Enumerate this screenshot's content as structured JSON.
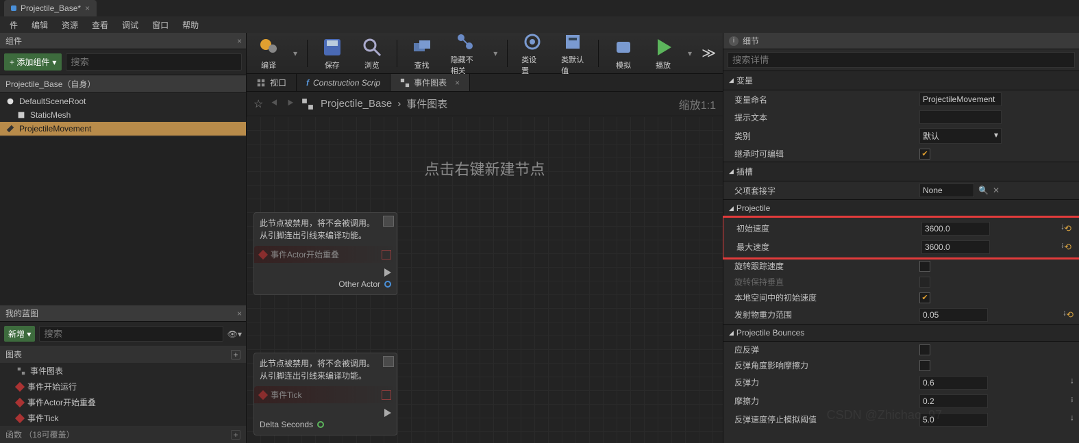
{
  "top_tab": {
    "title": "Projectile_Base*"
  },
  "menu": [
    "件",
    "编辑",
    "资源",
    "查看",
    "调试",
    "窗口",
    "帮助"
  ],
  "left": {
    "components_tab": "组件",
    "add_component": "+ 添加组件",
    "search_placeholder": "搜索",
    "root_label": "Projectile_Base（自身）",
    "tree": [
      {
        "name": "DefaultSceneRoot",
        "indent": 0
      },
      {
        "name": "StaticMesh",
        "indent": 1
      },
      {
        "name": "ProjectileMovement",
        "indent": 0,
        "selected": true
      }
    ],
    "myblueprint_tab": "我的蓝图",
    "new_btn": "新增",
    "graph_section": "图表",
    "graph_items": [
      "事件图表",
      "事件开始运行",
      "事件Actor开始重叠",
      "事件Tick"
    ],
    "footer": "函数 （18可覆盖）"
  },
  "toolbar": {
    "compile": "编译",
    "save": "保存",
    "browse": "浏览",
    "find": "查找",
    "hide": "隐藏不相关",
    "class_settings": "类设置",
    "class_defaults": "类默认值",
    "simulate": "模拟",
    "play": "播放"
  },
  "subtabs": {
    "viewport": "视口",
    "construction": "Construction Scrip",
    "event_graph": "事件图表"
  },
  "graph": {
    "breadcrumb_root": "Projectile_Base",
    "breadcrumb_current": "事件图表",
    "zoom": "缩放1:1",
    "hint": "点击右键新建节点",
    "note_line1": "此节点被禁用，将不会被调用。",
    "note_line2": "从引脚连出引线来编译功能。",
    "node1_title": "事件Actor开始重叠",
    "node1_pin": "Other Actor",
    "node2_title": "事件Tick",
    "node2_pin": "Delta Seconds"
  },
  "details": {
    "tab": "细节",
    "search_placeholder": "搜索详情",
    "sections": {
      "variable": "变量",
      "var_name_label": "变量命名",
      "var_name_value": "ProjectileMovement",
      "tooltip_label": "提示文本",
      "tooltip_value": "",
      "category_label": "类别",
      "category_value": "默认",
      "editable_label": "继承时可编辑",
      "slot": "插槽",
      "parent_socket_label": "父项套接字",
      "parent_socket_value": "None",
      "projectile": "Projectile",
      "initial_speed_label": "初始速度",
      "initial_speed_value": "3600.0",
      "max_speed_label": "最大速度",
      "max_speed_value": "3600.0",
      "rot_follow_label": "旋转跟踪速度",
      "rot_vert_label": "旋转保持垂直",
      "local_space_label": "本地空间中的初始速度",
      "gravity_label": "发射物重力范围",
      "gravity_value": "0.05",
      "bounces": "Projectile Bounces",
      "should_bounce_label": "应反弹",
      "angle_affects_label": "反弹角度影响摩擦力",
      "bounciness_label": "反弹力",
      "bounciness_value": "0.6",
      "friction_label": "摩擦力",
      "friction_value": "0.2",
      "stop_threshold_label": "反弹速度停止模拟阈值",
      "stop_threshold_value": "5.0"
    }
  },
  "watermark": "CSDN @Zhichao_97"
}
